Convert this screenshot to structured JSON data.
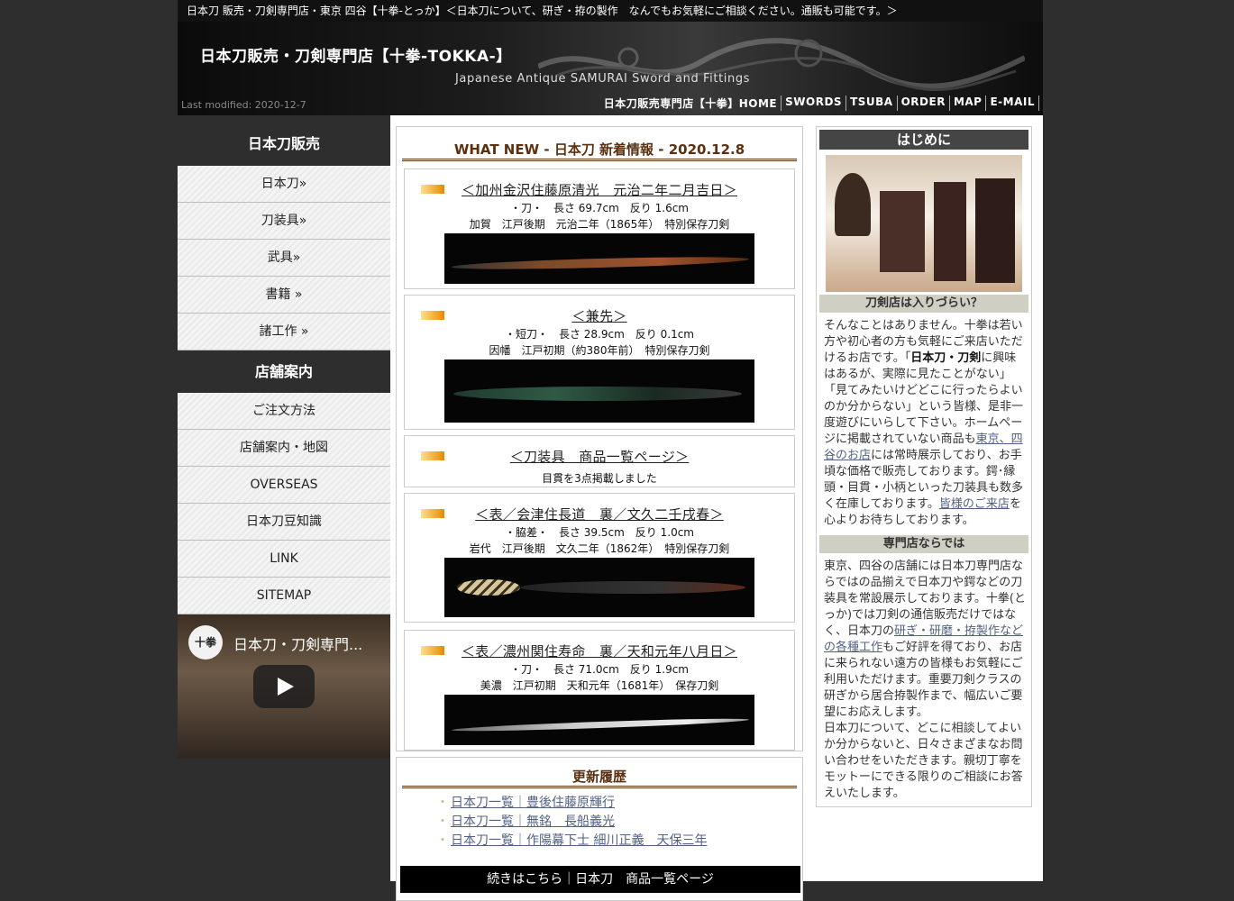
{
  "header": {
    "topbar_text": "日本刀 販売・刀剣専門店・東京 四谷【十拳-とっか】＜日本刀について、研ぎ・拵の製作　なんでもお気軽にご相談ください。通販も可能です。＞",
    "site_title": "日本刀販売・刀剣専門店【十拳-TOKKA-】",
    "site_subtitle": "Japanese Antique SAMURAI Sword and Fittings",
    "last_modified": "Last modified: 2020-12-7",
    "nav": [
      "日本刀販売専門店【十拳】HOME",
      "SWORDS",
      "TSUBA",
      "ORDER",
      "MAP",
      "E-MAIL"
    ]
  },
  "sidebar": {
    "heading1": "日本刀販売",
    "items1": [
      "日本刀»",
      "刀装具»",
      "武具»",
      "書籍 »",
      "諸工作 »"
    ],
    "heading2": "店舗案内",
    "items2": [
      "ご注文方法",
      "店舗案内・地図",
      "OVERSEAS",
      "日本刀豆知識",
      "LINK",
      "SITEMAP"
    ],
    "video": {
      "logo_text": "十拳",
      "title": "日本刀・刀剣専門..."
    }
  },
  "news": {
    "heading": "WHAT NEW - 日本刀 新着情報 - 2020.12.8",
    "items": [
      {
        "title": "＜加州金沢住藤原清光　元治二年二月吉日＞",
        "spec1": "・刀・　長さ 69.7cm　反り 1.6cm",
        "spec2": "加賀　江戸後期　元治二年（1865年）　特別保存刀剣"
      },
      {
        "title": "＜兼先＞",
        "spec1": "・短刀・　長さ 28.9cm　反り 0.1cm",
        "spec2": "因幡　江戸初期（約380年前）　特別保存刀剣"
      },
      {
        "title": "＜刀装具　商品一覧ページ＞",
        "spec1": "目貫を3点掲載しました"
      },
      {
        "title": "＜表／会津住長道　裏／文久二壬戌春＞",
        "spec1": "・脇差・　長さ 39.5cm　反り 1.0cm",
        "spec2": "岩代　江戸後期　文久二年（1862年）　特別保存刀剣"
      },
      {
        "title": "＜表／濃州関住寿命　裏／天和元年八月日＞",
        "spec1": "・刀・　長さ 71.0cm　反り 1.9cm",
        "spec2": "美濃　江戸初期　天和元年（1681年）　保存刀剣"
      }
    ]
  },
  "history": {
    "heading": "更新履歴",
    "items": [
      "日本刀一覧｜豊後住藤原輝行",
      "日本刀一覧｜無銘　長船義光",
      "日本刀一覧｜作陽幕下士 細川正義　天保三年"
    ],
    "more": "続きはこちら｜日本刀　商品一覧ページ"
  },
  "right": {
    "heading": "はじめに",
    "sub1": "刀剣店は入りづらい？",
    "text1_a": "そんなことはありません。十拳は若い方や初心者の方も気軽にご来店いただけるお店です。「",
    "text1_b": "日本刀・刀剣",
    "text1_c": "に興味はあるが、実際に見たことがない」「見てみたいけどどこに行ったらよいのか分からない」という皆様、是非一度遊びにいらして下さい。ホームページに掲載されていない商品も",
    "text1_link": "東京、四谷のお店",
    "text1_d": "には常時展示しており、お手頃な価格で販売しております。鍔･縁頭・目貫・小柄といった刀装具も数多く在庫しております。",
    "text1_link2": "皆様のご来店",
    "text1_e": "を心よりお待ちしております。",
    "sub2": "専門店ならでは",
    "text2_a": "東京、四谷の店舗には日本刀専門店ならではの品揃えで日本刀や鍔などの刀装具を常設展示しております。十拳(とっか)では刀剣の通信販売だけではなく、日本刀の",
    "text2_link": "研ぎ・研磨・拵製作などの各種工作",
    "text2_b": "もご好評を得ており、お店に来られない遠方の皆様もお気軽にご利用いただけます。重要刀剣クラスの研ぎから居合拵製作まで、幅広いご要望にお応えします。",
    "text2_c": "日本刀について、どこに相談してよいか分からないと、日々さまざまなお問い合わせをいただきます。親切丁寧をモットーにできる限りのご相談にお答えいたします。"
  }
}
